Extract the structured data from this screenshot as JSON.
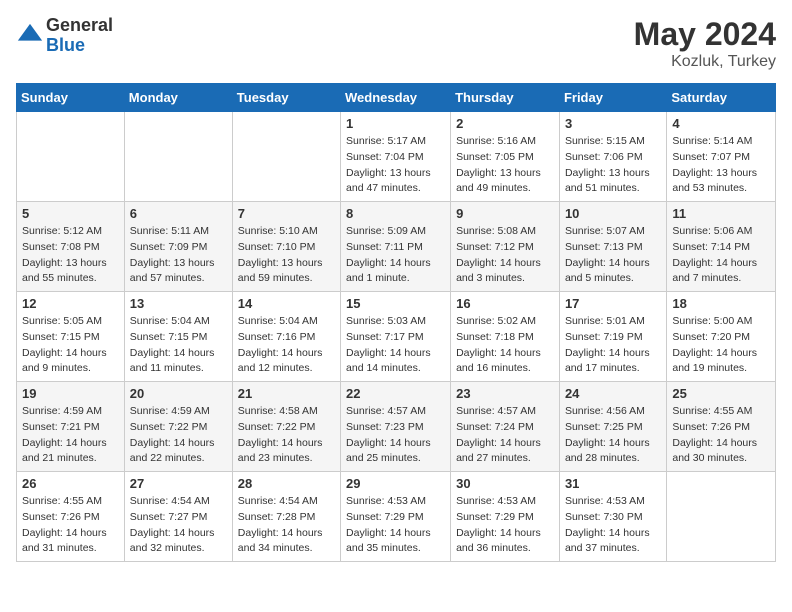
{
  "header": {
    "logo_general": "General",
    "logo_blue": "Blue",
    "month_year": "May 2024",
    "location": "Kozluk, Turkey"
  },
  "days_of_week": [
    "Sunday",
    "Monday",
    "Tuesday",
    "Wednesday",
    "Thursday",
    "Friday",
    "Saturday"
  ],
  "weeks": [
    [
      {
        "day": "",
        "sunrise": "",
        "sunset": "",
        "daylight": ""
      },
      {
        "day": "",
        "sunrise": "",
        "sunset": "",
        "daylight": ""
      },
      {
        "day": "",
        "sunrise": "",
        "sunset": "",
        "daylight": ""
      },
      {
        "day": "1",
        "sunrise": "Sunrise: 5:17 AM",
        "sunset": "Sunset: 7:04 PM",
        "daylight": "Daylight: 13 hours and 47 minutes."
      },
      {
        "day": "2",
        "sunrise": "Sunrise: 5:16 AM",
        "sunset": "Sunset: 7:05 PM",
        "daylight": "Daylight: 13 hours and 49 minutes."
      },
      {
        "day": "3",
        "sunrise": "Sunrise: 5:15 AM",
        "sunset": "Sunset: 7:06 PM",
        "daylight": "Daylight: 13 hours and 51 minutes."
      },
      {
        "day": "4",
        "sunrise": "Sunrise: 5:14 AM",
        "sunset": "Sunset: 7:07 PM",
        "daylight": "Daylight: 13 hours and 53 minutes."
      }
    ],
    [
      {
        "day": "5",
        "sunrise": "Sunrise: 5:12 AM",
        "sunset": "Sunset: 7:08 PM",
        "daylight": "Daylight: 13 hours and 55 minutes."
      },
      {
        "day": "6",
        "sunrise": "Sunrise: 5:11 AM",
        "sunset": "Sunset: 7:09 PM",
        "daylight": "Daylight: 13 hours and 57 minutes."
      },
      {
        "day": "7",
        "sunrise": "Sunrise: 5:10 AM",
        "sunset": "Sunset: 7:10 PM",
        "daylight": "Daylight: 13 hours and 59 minutes."
      },
      {
        "day": "8",
        "sunrise": "Sunrise: 5:09 AM",
        "sunset": "Sunset: 7:11 PM",
        "daylight": "Daylight: 14 hours and 1 minute."
      },
      {
        "day": "9",
        "sunrise": "Sunrise: 5:08 AM",
        "sunset": "Sunset: 7:12 PM",
        "daylight": "Daylight: 14 hours and 3 minutes."
      },
      {
        "day": "10",
        "sunrise": "Sunrise: 5:07 AM",
        "sunset": "Sunset: 7:13 PM",
        "daylight": "Daylight: 14 hours and 5 minutes."
      },
      {
        "day": "11",
        "sunrise": "Sunrise: 5:06 AM",
        "sunset": "Sunset: 7:14 PM",
        "daylight": "Daylight: 14 hours and 7 minutes."
      }
    ],
    [
      {
        "day": "12",
        "sunrise": "Sunrise: 5:05 AM",
        "sunset": "Sunset: 7:15 PM",
        "daylight": "Daylight: 14 hours and 9 minutes."
      },
      {
        "day": "13",
        "sunrise": "Sunrise: 5:04 AM",
        "sunset": "Sunset: 7:15 PM",
        "daylight": "Daylight: 14 hours and 11 minutes."
      },
      {
        "day": "14",
        "sunrise": "Sunrise: 5:04 AM",
        "sunset": "Sunset: 7:16 PM",
        "daylight": "Daylight: 14 hours and 12 minutes."
      },
      {
        "day": "15",
        "sunrise": "Sunrise: 5:03 AM",
        "sunset": "Sunset: 7:17 PM",
        "daylight": "Daylight: 14 hours and 14 minutes."
      },
      {
        "day": "16",
        "sunrise": "Sunrise: 5:02 AM",
        "sunset": "Sunset: 7:18 PM",
        "daylight": "Daylight: 14 hours and 16 minutes."
      },
      {
        "day": "17",
        "sunrise": "Sunrise: 5:01 AM",
        "sunset": "Sunset: 7:19 PM",
        "daylight": "Daylight: 14 hours and 17 minutes."
      },
      {
        "day": "18",
        "sunrise": "Sunrise: 5:00 AM",
        "sunset": "Sunset: 7:20 PM",
        "daylight": "Daylight: 14 hours and 19 minutes."
      }
    ],
    [
      {
        "day": "19",
        "sunrise": "Sunrise: 4:59 AM",
        "sunset": "Sunset: 7:21 PM",
        "daylight": "Daylight: 14 hours and 21 minutes."
      },
      {
        "day": "20",
        "sunrise": "Sunrise: 4:59 AM",
        "sunset": "Sunset: 7:22 PM",
        "daylight": "Daylight: 14 hours and 22 minutes."
      },
      {
        "day": "21",
        "sunrise": "Sunrise: 4:58 AM",
        "sunset": "Sunset: 7:22 PM",
        "daylight": "Daylight: 14 hours and 23 minutes."
      },
      {
        "day": "22",
        "sunrise": "Sunrise: 4:57 AM",
        "sunset": "Sunset: 7:23 PM",
        "daylight": "Daylight: 14 hours and 25 minutes."
      },
      {
        "day": "23",
        "sunrise": "Sunrise: 4:57 AM",
        "sunset": "Sunset: 7:24 PM",
        "daylight": "Daylight: 14 hours and 27 minutes."
      },
      {
        "day": "24",
        "sunrise": "Sunrise: 4:56 AM",
        "sunset": "Sunset: 7:25 PM",
        "daylight": "Daylight: 14 hours and 28 minutes."
      },
      {
        "day": "25",
        "sunrise": "Sunrise: 4:55 AM",
        "sunset": "Sunset: 7:26 PM",
        "daylight": "Daylight: 14 hours and 30 minutes."
      }
    ],
    [
      {
        "day": "26",
        "sunrise": "Sunrise: 4:55 AM",
        "sunset": "Sunset: 7:26 PM",
        "daylight": "Daylight: 14 hours and 31 minutes."
      },
      {
        "day": "27",
        "sunrise": "Sunrise: 4:54 AM",
        "sunset": "Sunset: 7:27 PM",
        "daylight": "Daylight: 14 hours and 32 minutes."
      },
      {
        "day": "28",
        "sunrise": "Sunrise: 4:54 AM",
        "sunset": "Sunset: 7:28 PM",
        "daylight": "Daylight: 14 hours and 34 minutes."
      },
      {
        "day": "29",
        "sunrise": "Sunrise: 4:53 AM",
        "sunset": "Sunset: 7:29 PM",
        "daylight": "Daylight: 14 hours and 35 minutes."
      },
      {
        "day": "30",
        "sunrise": "Sunrise: 4:53 AM",
        "sunset": "Sunset: 7:29 PM",
        "daylight": "Daylight: 14 hours and 36 minutes."
      },
      {
        "day": "31",
        "sunrise": "Sunrise: 4:53 AM",
        "sunset": "Sunset: 7:30 PM",
        "daylight": "Daylight: 14 hours and 37 minutes."
      },
      {
        "day": "",
        "sunrise": "",
        "sunset": "",
        "daylight": ""
      }
    ]
  ]
}
